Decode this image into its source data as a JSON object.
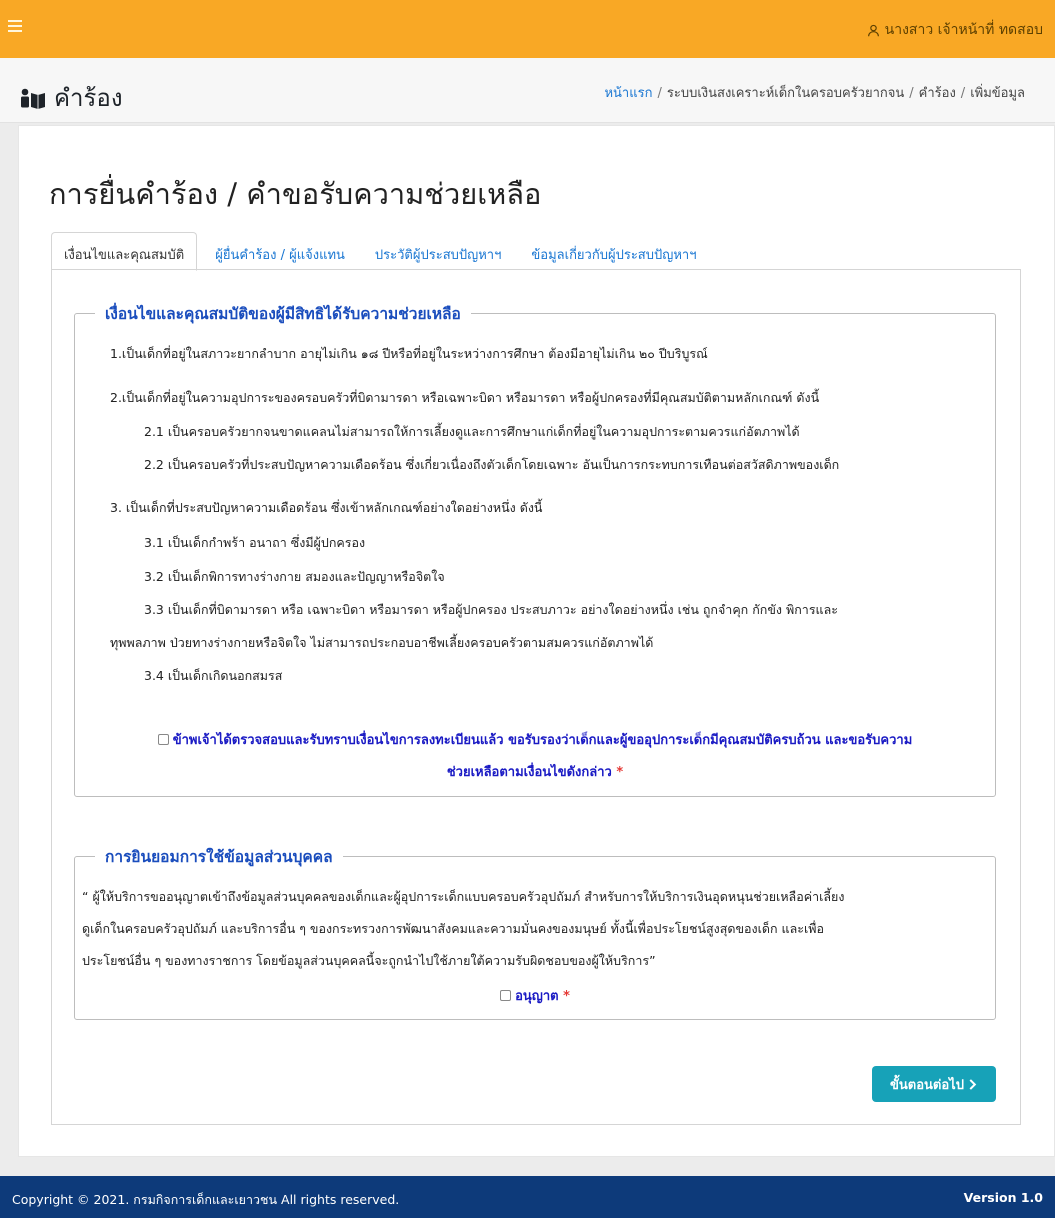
{
  "header": {
    "user_name": "นางสาว เจ้าหน้าที่ ทดสอบ",
    "page_title": "คำร้อง"
  },
  "breadcrumb": {
    "home": "หน้าแรก",
    "system": "ระบบเงินสงเคราะห์เด็กในครอบครัวยากจน",
    "section": "คำร้อง",
    "current": "เพิ่มข้อมูล",
    "separator": "/"
  },
  "form": {
    "title": "การยื่นคำร้อง / คำขอรับความช่วยเหลือ"
  },
  "tabs": [
    {
      "label": "เงื่อนไขและคุณสมบัติ",
      "active": true
    },
    {
      "label": "ผู้ยื่นคำร้อง / ผู้แจ้งแทน",
      "active": false
    },
    {
      "label": "ประวัติผู้ประสบปัญหาฯ",
      "active": false
    },
    {
      "label": "ข้อมูลเกี่ยวกับผู้ประสบปัญหาฯ",
      "active": false
    }
  ],
  "conditions": {
    "legend": "เงื่อนไขและคุณสมบัติของผู้มีสิทธิได้รับความช่วยเหลือ",
    "lines": [
      "1.เป็นเด็กที่อยู่ในสภาวะยากลำบาก อายุไม่เกิน ๑๘ ปีหรือที่อยู่ในระหว่างการศึกษา ต้องมีอายุไม่เกิน ๒๐ ปีบริบูรณ์",
      "2.เป็นเด็กที่อยู่ในความอุปการะของครอบครัวที่บิดามารดา หรือเฉพาะบิดา หรือมารดา หรือผู้ปกครองที่มีคุณสมบัติตามหลักเกณฑ์ ดังนี้",
      "2.1 เป็นครอบครัวยากจนขาดแคลนไม่สามารถให้การเลี้ยงดูและการศึกษาแก่เด็กที่อยู่ในความอุปการะตามควรแก่อัตภาพได้",
      "2.2 เป็นครอบครัวที่ประสบปัญหาความเดือดร้อน ซึ่งเกี่ยวเนื่องถึงตัวเด็กโดยเฉพาะ อันเป็นการกระทบการเทือนต่อสวัสดิภาพของเด็ก",
      "3. เป็นเด็กที่ประสบปัญหาความเดือดร้อน ซึ่งเข้าหลักเกณฑ์อย่างใดอย่างหนึ่ง ดังนี้",
      "3.1 เป็นเด็กกำพร้า อนาถา ซึ่งมีผู้ปกครอง",
      "3.2 เป็นเด็กพิการทางร่างกาย สมองและปัญญาหรือจิตใจ",
      "3.3 เป็นเด็กที่บิดามารดา หรือ เฉพาะบิดา หรือมารดา หรือผู้ปกครอง ประสบภาวะ อย่างใดอย่างหนึ่ง เช่น ถูกจำคุก กักขัง พิการและ",
      "ทุพพลภาพ ป่วยทางร่างกายหรือจิตใจ ไม่สามารถประกอบอาชีพเลี้ยงครอบครัวตามสมควรแก่อัตภาพได้",
      "3.4 เป็นเด็กเกิดนอกสมรส"
    ],
    "consent_line1": "ข้าพเจ้าได้ตรวจสอบและรับทราบเงื่อนไขการลงทะเบียนแล้ว ขอรับรองว่าเด็กและผู้ขออุปการะเด็กมีคุณสมบัติครบถ้วน และขอรับความ",
    "consent_line2": "ช่วยเหลือตามเงื่อนไขดังกล่าว",
    "required_mark": "*"
  },
  "privacy": {
    "legend": "การยินยอมการใช้ข้อมูลส่วนบุคคล",
    "lines": [
      "“ ผู้ให้บริการขออนุญาตเข้าถึงข้อมูลส่วนบุคคลของเด็กและผู้อุปการะเด็กแบบครอบครัวอุปถัมภ์ สำหรับการให้บริการเงินอุดหนุนช่วยเหลือค่าเลี้ยง",
      "ดูเด็กในครอบครัวอุปถัมภ์ และบริการอื่น ๆ ของกระทรวงการพัฒนาสังคมและความมั่นคงของมนุษย์ ทั้งนี้เพื่อประโยชน์สูงสุดของเด็ก และเพื่อ",
      "ประโยชน์อื่น ๆ ของทางราชการ โดยข้อมูลส่วนบุคคลนี้จะถูกนำไปใช้ภายใต้ความรับผิดชอบของผู้ให้บริการ”"
    ],
    "allow_label": "อนุญาต",
    "required_mark": "*"
  },
  "actions": {
    "next_label": "ขั้นตอนต่อไป"
  },
  "footer": {
    "copyright": "Copyright © 2021. กรมกิจการเด็กและเยาวชน All rights reserved.",
    "version": "Version 1.0"
  },
  "colors": {
    "topbar": "#f9a825",
    "footer": "#0d3a7a",
    "link": "#1976d2",
    "legend": "#1a4dbd",
    "consent": "#1a1ac4",
    "required": "#e53935",
    "button": "#17a2b8"
  },
  "icons": {
    "menu": "hamburger-icon",
    "user": "user-icon",
    "page": "people-book-icon",
    "next": "chevron-right-icon"
  }
}
